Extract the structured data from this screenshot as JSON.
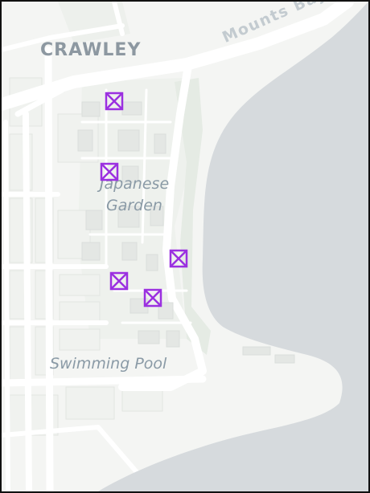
{
  "map": {
    "labels": {
      "suburb": "CRAWLEY",
      "road": "Mounts Bay",
      "garden_line1": "Japanese",
      "garden_line2": "Garden",
      "pool": "Swimming Pool"
    },
    "markers": [
      {
        "name": "marker-1",
        "icon": "square-cross-marker"
      },
      {
        "name": "marker-2",
        "icon": "square-cross-marker"
      },
      {
        "name": "marker-3",
        "icon": "square-cross-marker"
      },
      {
        "name": "marker-4",
        "icon": "square-cross-marker"
      },
      {
        "name": "marker-5",
        "icon": "square-cross-marker"
      }
    ],
    "colors": {
      "land": "#f4f5f3",
      "water": "#d6dadd",
      "road": "#ffffff",
      "park": "#e7ece7",
      "marker": "#9b30e0"
    }
  }
}
